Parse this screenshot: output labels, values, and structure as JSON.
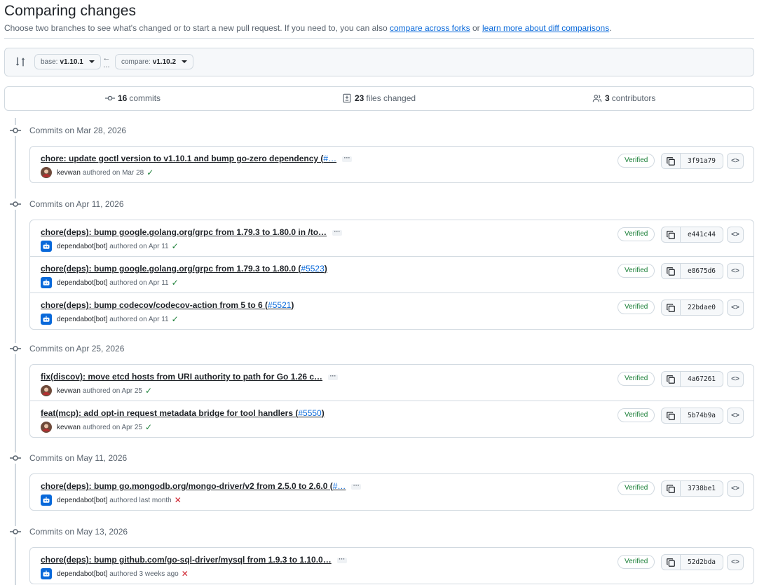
{
  "header": {
    "title": "Comparing changes",
    "subtitle_prefix": "Choose two branches to see what's changed or to start a new pull request. If you need to, you can also ",
    "link_forks": "compare across forks",
    "subtitle_or": " or ",
    "link_learn": "learn more about diff comparisons",
    "subtitle_end": "."
  },
  "range": {
    "base_label": "base:",
    "base_value": "v1.10.1",
    "compare_label": "compare:",
    "compare_value": "v1.10.2",
    "arrow": "←",
    "dots": "..."
  },
  "summary": {
    "commits_count": "16",
    "commits_label": "commits",
    "files_count": "23",
    "files_label": "files changed",
    "contributors_count": "3",
    "contributors_label": "contributors"
  },
  "groups": [
    {
      "date": "Commits on Mar 28, 2026",
      "commits": [
        {
          "title": "chore: update goctl version to v1.10.1 and bump go-zero dependency (",
          "pr": "#…",
          "close": "",
          "truncated": true,
          "author": "kevwan",
          "meta": "authored on Mar 28",
          "status": "✓",
          "ok": true,
          "bot": false,
          "verified": "Verified",
          "sha": "3f91a79"
        }
      ]
    },
    {
      "date": "Commits on Apr 11, 2026",
      "commits": [
        {
          "title": "chore(deps): bump google.golang.org/grpc from 1.79.3 to 1.80.0 in /to…",
          "pr": "",
          "close": "",
          "truncated": true,
          "author": "dependabot[bot]",
          "meta": "authored on Apr 11",
          "status": "✓",
          "ok": true,
          "bot": true,
          "verified": "Verified",
          "sha": "e441c44"
        },
        {
          "title": "chore(deps): bump google.golang.org/grpc from 1.79.3 to 1.80.0 (",
          "pr": "#5523",
          "close": ")",
          "truncated": false,
          "author": "dependabot[bot]",
          "meta": "authored on Apr 11",
          "status": "✓",
          "ok": true,
          "bot": true,
          "verified": "Verified",
          "sha": "e8675d6"
        },
        {
          "title": "chore(deps): bump codecov/codecov-action from 5 to 6 (",
          "pr": "#5521",
          "close": ")",
          "truncated": false,
          "author": "dependabot[bot]",
          "meta": "authored on Apr 11",
          "status": "✓",
          "ok": true,
          "bot": true,
          "verified": "Verified",
          "sha": "22bdae0"
        }
      ]
    },
    {
      "date": "Commits on Apr 25, 2026",
      "commits": [
        {
          "title": "fix(discov): move etcd hosts from URI authority to path for Go 1.26 c…",
          "pr": "",
          "close": "",
          "truncated": true,
          "author": "kevwan",
          "meta": "authored on Apr 25",
          "status": "✓",
          "ok": true,
          "bot": false,
          "verified": "Verified",
          "sha": "4a67261"
        },
        {
          "title": "feat(mcp): add opt-in request metadata bridge for tool handlers (",
          "pr": "#5550",
          "close": ")",
          "truncated": false,
          "author": "kevwan",
          "meta": "authored on Apr 25",
          "status": "✓",
          "ok": true,
          "bot": false,
          "verified": "Verified",
          "sha": "5b74b9a"
        }
      ]
    },
    {
      "date": "Commits on May 11, 2026",
      "commits": [
        {
          "title": "chore(deps): bump go.mongodb.org/mongo-driver/v2 from 2.5.0 to 2.6.0 (",
          "pr": "#…",
          "close": "",
          "truncated": true,
          "author": "dependabot[bot]",
          "meta": "authored last month",
          "status": "✕",
          "ok": false,
          "bot": true,
          "verified": "Verified",
          "sha": "3738be1"
        }
      ]
    },
    {
      "date": "Commits on May 13, 2026",
      "commits": [
        {
          "title": "chore(deps): bump github.com/go-sql-driver/mysql from 1.9.3 to 1.10.0…",
          "pr": "",
          "close": "",
          "truncated": true,
          "author": "dependabot[bot]",
          "meta": "authored 3 weeks ago",
          "status": "✕",
          "ok": false,
          "bot": true,
          "verified": "Verified",
          "sha": "52d2bda"
        }
      ]
    }
  ]
}
